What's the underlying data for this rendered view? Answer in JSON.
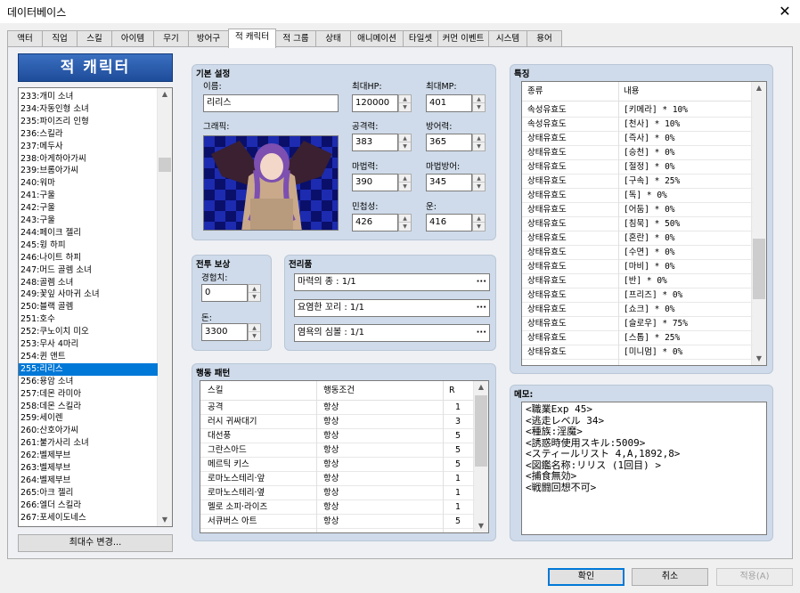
{
  "window": {
    "title": "데이터베이스"
  },
  "tabs": [
    "액터",
    "직업",
    "스킬",
    "아이템",
    "무기",
    "방어구",
    "적 캐릭터",
    "적 그룹",
    "상태",
    "애니메이션",
    "타일셋",
    "커먼 이벤트",
    "시스템",
    "용어"
  ],
  "enemy_list": {
    "header": "적 캐릭터",
    "items": [
      "233:개미 소녀",
      "234:자동인형 소녀",
      "235:파이즈리 인형",
      "236:스킬라",
      "237:메두사",
      "238:아게하아가씨",
      "239:브롬아가씨",
      "240:워마",
      "241:구울",
      "242:구울",
      "243:구울",
      "244:페이크 젤리",
      "245:윙 하피",
      "246:나이트 하피",
      "247:머드 골렘 소녀",
      "248:골렘 소녀",
      "249:꽃잎 사마귀 소녀",
      "250:블랙 골렘",
      "251:호수",
      "252:쿠노이치 미오",
      "253:무사 4마리",
      "254:퀸 앤트",
      "255:리리스",
      "256:용암 소녀",
      "257:데몬 라미아",
      "258:데몬 스킬라",
      "259:세이렌",
      "260:산호아가씨",
      "261:불가사리 소녀",
      "262:벨제부브",
      "263:벨제부브",
      "264:벨제부브",
      "265:아크 젤리",
      "266:엘더 스킬라",
      "267:포세이도네스"
    ],
    "selected_index": 22,
    "max_button": "최대수 변경..."
  },
  "basic": {
    "title": "기본 설정",
    "name_label": "이름:",
    "name": "리리스",
    "graphic_label": "그래픽:",
    "maxhp_label": "최대HP:",
    "maxhp": "120000",
    "maxmp_label": "최대MP:",
    "maxmp": "401",
    "atk_label": "공격력:",
    "atk": "383",
    "def_label": "방어력:",
    "def": "365",
    "mat_label": "마법력:",
    "mat": "390",
    "mdf_label": "마법방어:",
    "mdf": "345",
    "agi_label": "민첩성:",
    "agi": "426",
    "luk_label": "운:",
    "luk": "416"
  },
  "rewards": {
    "title": "전투 보상",
    "exp_label": "경험치:",
    "exp": "0",
    "gold_label": "돈:",
    "gold": "3300"
  },
  "drops": {
    "title": "전리품",
    "items": [
      "마력의 종 : 1/1",
      "요염한 꼬리 : 1/1",
      "염욕의 심볼 : 1/1"
    ]
  },
  "actions": {
    "title": "행동 패턴",
    "headers": [
      "스킬",
      "행동조건",
      "R"
    ],
    "rows": [
      [
        "공격",
        "항상",
        "1"
      ],
      [
        "러시 귀싸대기",
        "항상",
        "3"
      ],
      [
        "대선풍",
        "항상",
        "5"
      ],
      [
        "그란스아드",
        "항상",
        "5"
      ],
      [
        "메르틱 키스",
        "항상",
        "5"
      ],
      [
        "로마노스테리·앞",
        "항상",
        "1"
      ],
      [
        "로마노스테리·옆",
        "항상",
        "1"
      ],
      [
        "멜로 소피·라이즈",
        "항상",
        "1"
      ],
      [
        "서큐버스 아트",
        "항상",
        "5"
      ]
    ]
  },
  "traits": {
    "title": "특징",
    "headers": [
      "종류",
      "내용"
    ],
    "rows": [
      [
        "속성유효도",
        "[키메라] * 10%"
      ],
      [
        "속성유효도",
        "[천사] * 10%"
      ],
      [
        "상태유효도",
        "[즉사] * 0%"
      ],
      [
        "상태유효도",
        "[승천] * 0%"
      ],
      [
        "상태유효도",
        "[절정] * 0%"
      ],
      [
        "상태유효도",
        "[구속] * 25%"
      ],
      [
        "상태유효도",
        "[독] * 0%"
      ],
      [
        "상태유효도",
        "[어둠] * 0%"
      ],
      [
        "상태유효도",
        "[침묵] * 50%"
      ],
      [
        "상태유효도",
        "[혼란] * 0%"
      ],
      [
        "상태유효도",
        "[수면] * 0%"
      ],
      [
        "상태유효도",
        "[마비] * 0%"
      ],
      [
        "상태유효도",
        "[반] * 0%"
      ],
      [
        "상태유효도",
        "[프리즈] * 0%"
      ],
      [
        "상태유효도",
        "[쇼크] * 0%"
      ],
      [
        "상태유효도",
        "[슬로우] * 75%"
      ],
      [
        "상태유효도",
        "[스톱] * 25%"
      ],
      [
        "상태유효도",
        "[미니멈] * 0%"
      ]
    ]
  },
  "memo": {
    "title": "메모:",
    "lines": [
      "<職業Exp 45>",
      "<逃走レベル 34>",
      "<種族:淫魔>",
      "<誘惑時使用スキル:5009>",
      "<スティールリスト 4,A,1892,8>",
      "<図鑑名称:リリス (1回目) >",
      "<捕食無効>",
      "<戦闘回想不可>"
    ]
  },
  "footer": {
    "ok": "확인",
    "cancel": "취소",
    "apply": "적용(A)"
  },
  "colors": {
    "accent": "#0078d7",
    "group_bg": "#cfdbea",
    "header_bg": "#2a5cae"
  }
}
